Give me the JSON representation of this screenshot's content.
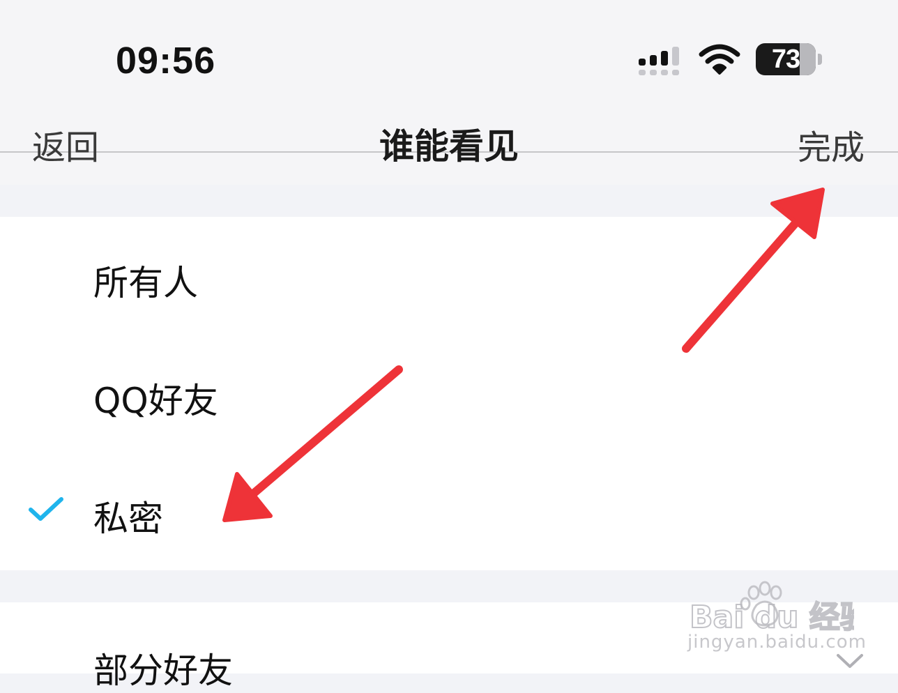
{
  "status_bar": {
    "time": "09:56",
    "battery_level": "73",
    "battery_fraction": 0.73
  },
  "nav": {
    "back_label": "返回",
    "title": "谁能看见",
    "done_label": "完成"
  },
  "options": [
    {
      "label": "所有人",
      "selected": false
    },
    {
      "label": "QQ好友",
      "selected": false
    },
    {
      "label": "私密",
      "selected": true
    }
  ],
  "partial_option": {
    "label": "部分好友"
  },
  "watermark": {
    "brand": "Bai du 经验",
    "url": "jingyan.baidu.com"
  },
  "colors": {
    "check_accent": "#1fb4ec",
    "annotation_red": "#ee3338"
  }
}
